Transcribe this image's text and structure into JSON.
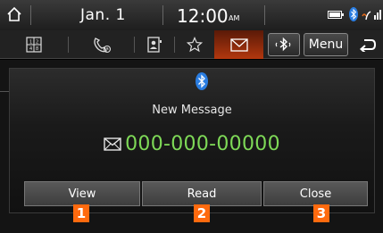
{
  "status_bar": {
    "date": "Jan. 1",
    "time": "12:00",
    "ampm": "AM"
  },
  "toolbar": {
    "items": [
      "keypad-icon",
      "call-history-icon",
      "contacts-icon",
      "favorites-icon",
      "messages-icon",
      "bluetooth-settings-icon"
    ],
    "active": "messages-icon",
    "menu_label": "Menu",
    "back_icon": "back-arrow-icon"
  },
  "popup": {
    "icon": "bluetooth-icon",
    "title": "New Message",
    "phone_icon": "envelope-icon",
    "phone_number": "000-000-00000",
    "actions": [
      {
        "label": "View",
        "callout": "1"
      },
      {
        "label": "Read",
        "callout": "2"
      },
      {
        "label": "Close",
        "callout": "3"
      }
    ]
  },
  "colors": {
    "accent": "#b3370e",
    "phone_text": "#7ed957",
    "callout": "#ff6a0e"
  }
}
